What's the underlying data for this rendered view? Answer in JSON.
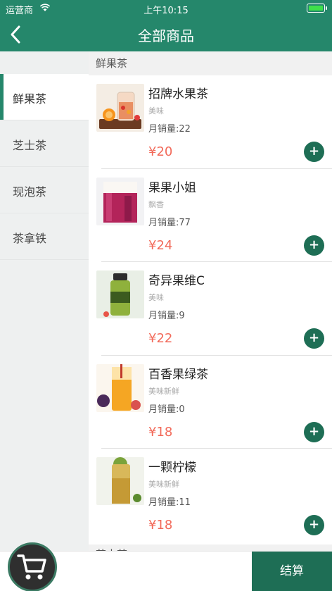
{
  "status_bar": {
    "carrier": "运营商",
    "time": "上午10:15"
  },
  "nav": {
    "title": "全部商品"
  },
  "sidebar": {
    "items": [
      {
        "label": "鲜果茶",
        "active": true
      },
      {
        "label": "芝士茶",
        "active": false
      },
      {
        "label": "现泡茶",
        "active": false
      },
      {
        "label": "茶拿铁",
        "active": false
      }
    ]
  },
  "section": {
    "title": "鲜果茶",
    "next_title": "芝士茶"
  },
  "products": [
    {
      "name": "招牌水果茶",
      "desc": "美味",
      "sales": "月销量:22",
      "price": "¥20",
      "add": "+"
    },
    {
      "name": "果果小姐",
      "desc": "飘香",
      "sales": "月销量:77",
      "price": "¥24",
      "add": "+"
    },
    {
      "name": "奇异果维C",
      "desc": "美味",
      "sales": "月销量:9",
      "price": "¥22",
      "add": "+"
    },
    {
      "name": "百香果绿茶",
      "desc": "美味新鲜",
      "sales": "月销量:0",
      "price": "¥18",
      "add": "+"
    },
    {
      "name": "一颗柠檬",
      "desc": "美味新鲜",
      "sales": "月销量:11",
      "price": "¥18",
      "add": "+"
    }
  ],
  "bottom": {
    "checkout_label": "结算"
  },
  "colors": {
    "primary": "#25876b",
    "button": "#1e6e55",
    "price": "#f26a5a"
  }
}
